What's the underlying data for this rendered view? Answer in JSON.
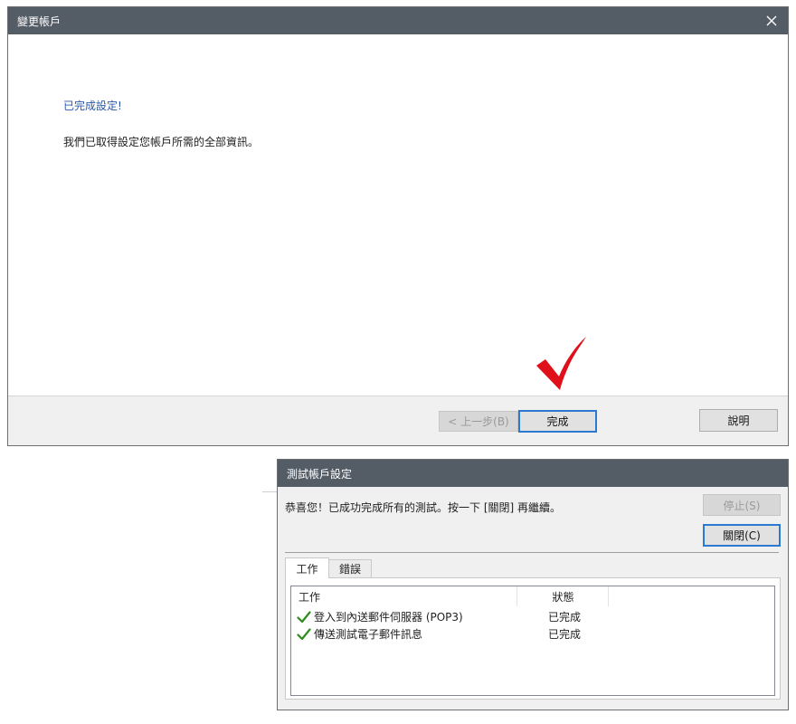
{
  "window1": {
    "title": "變更帳戶",
    "close_icon": "close-icon",
    "heading": "已完成設定!",
    "body": "我們已取得設定您帳戶所需的全部資訊。",
    "buttons": {
      "back": "< 上一步(B)",
      "finish": "完成",
      "help": "說明"
    },
    "annotation_icon": "red-checkmark-icon",
    "colors": {
      "titlebar": "#545c66",
      "heading": "#2a58a8",
      "annotation": "#e0101a"
    }
  },
  "window2": {
    "title": "測試帳戶設定",
    "message": "恭喜您！已成功完成所有的測試。按一下 [關閉] 再繼續。",
    "buttons": {
      "stop": "停止(S)",
      "close": "關閉(C)"
    },
    "tabs": [
      {
        "label": "工作"
      },
      {
        "label": "錯誤"
      }
    ],
    "columns": [
      "工作",
      "狀態"
    ],
    "rows": [
      {
        "task": "登入到內送郵件伺服器 (POP3)",
        "status": "已完成",
        "icon": "green-check-icon"
      },
      {
        "task": "傳送測試電子郵件訊息",
        "status": "已完成",
        "icon": "green-check-icon"
      }
    ]
  }
}
